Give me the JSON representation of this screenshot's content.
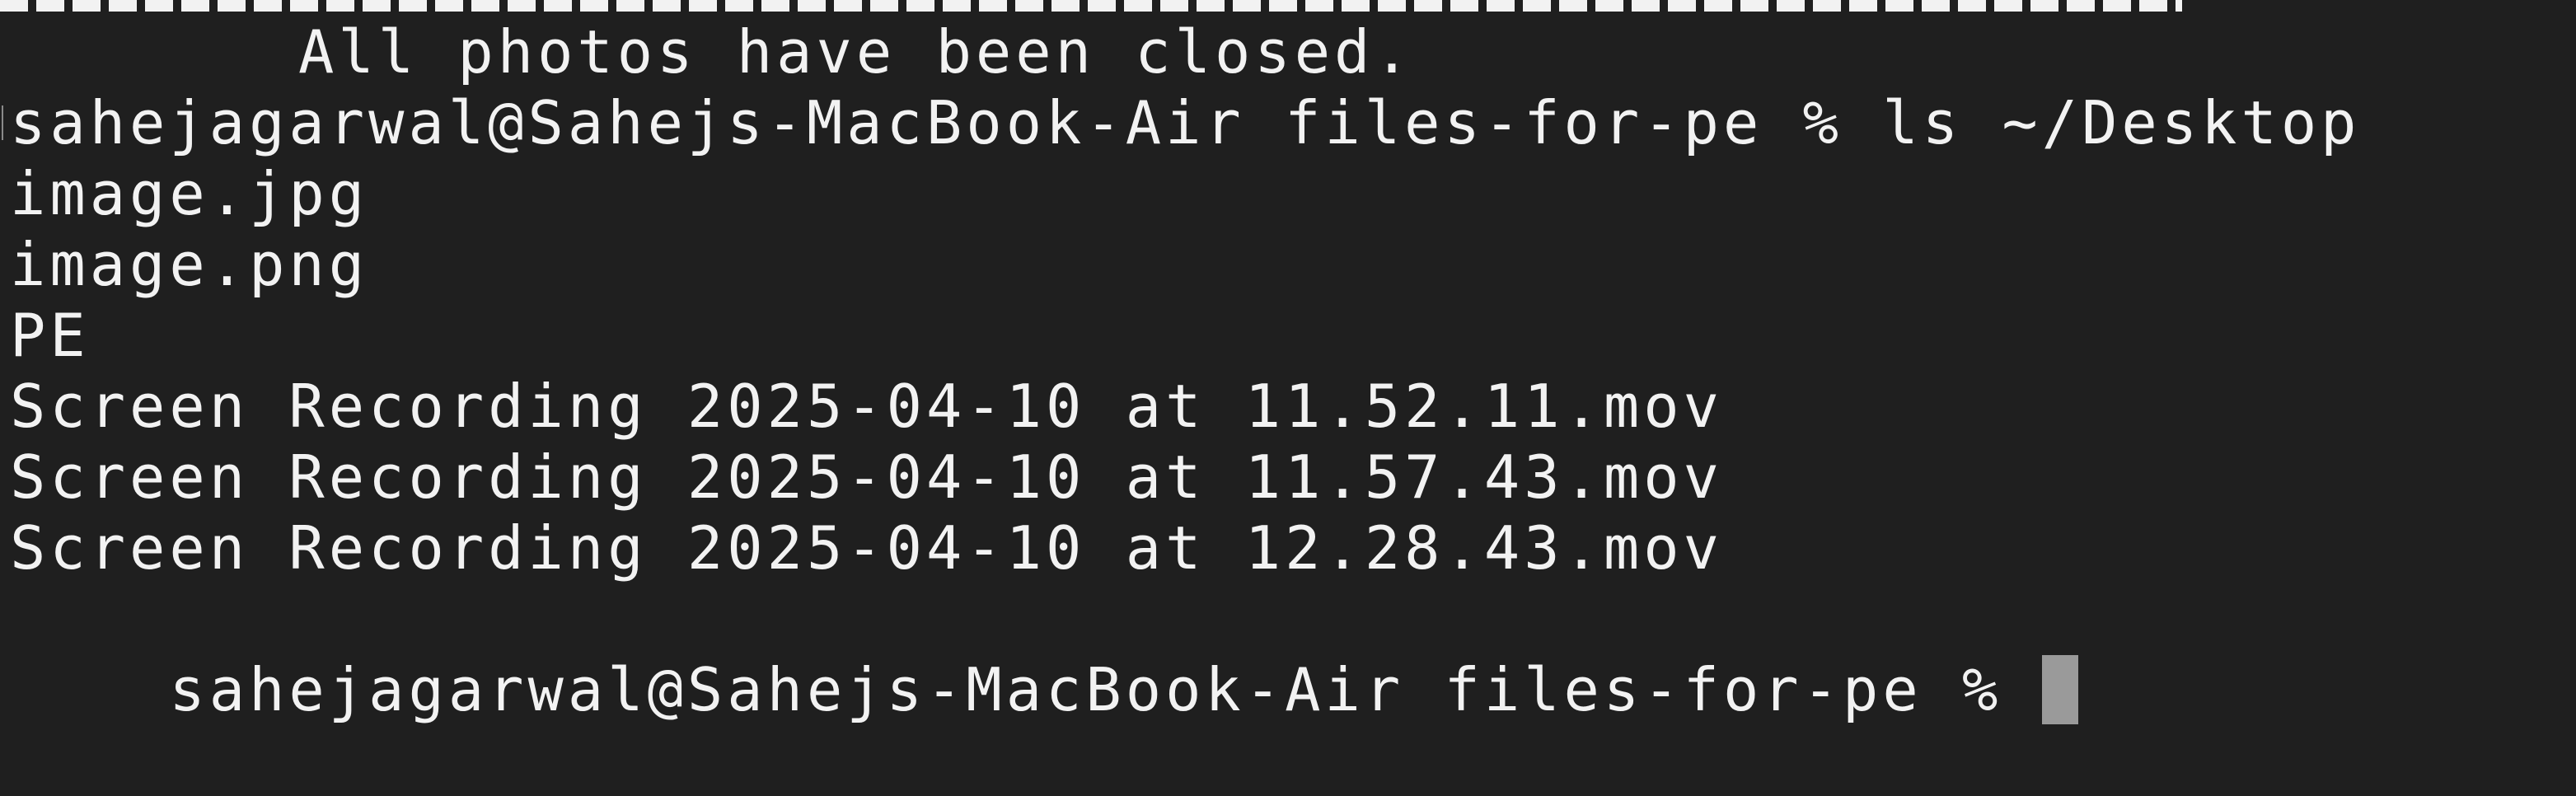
{
  "terminal": {
    "message": "All photos have been closed.",
    "command_line": "sahejagarwal@Sahejs-MacBook-Air files-for-pe % ls ~/Desktop",
    "files": [
      "image.jpg",
      "image.png",
      "PE",
      "Screen Recording 2025-04-10 at 11.52.11.mov",
      "Screen Recording 2025-04-10 at 11.57.43.mov",
      "Screen Recording 2025-04-10 at 12.28.43.mov"
    ],
    "prompt": "sahejagarwal@Sahejs-MacBook-Air files-for-pe % "
  },
  "colors": {
    "background": "#1f1f1f",
    "text": "#f2f2f2",
    "cursor": "#9a9a9a"
  }
}
